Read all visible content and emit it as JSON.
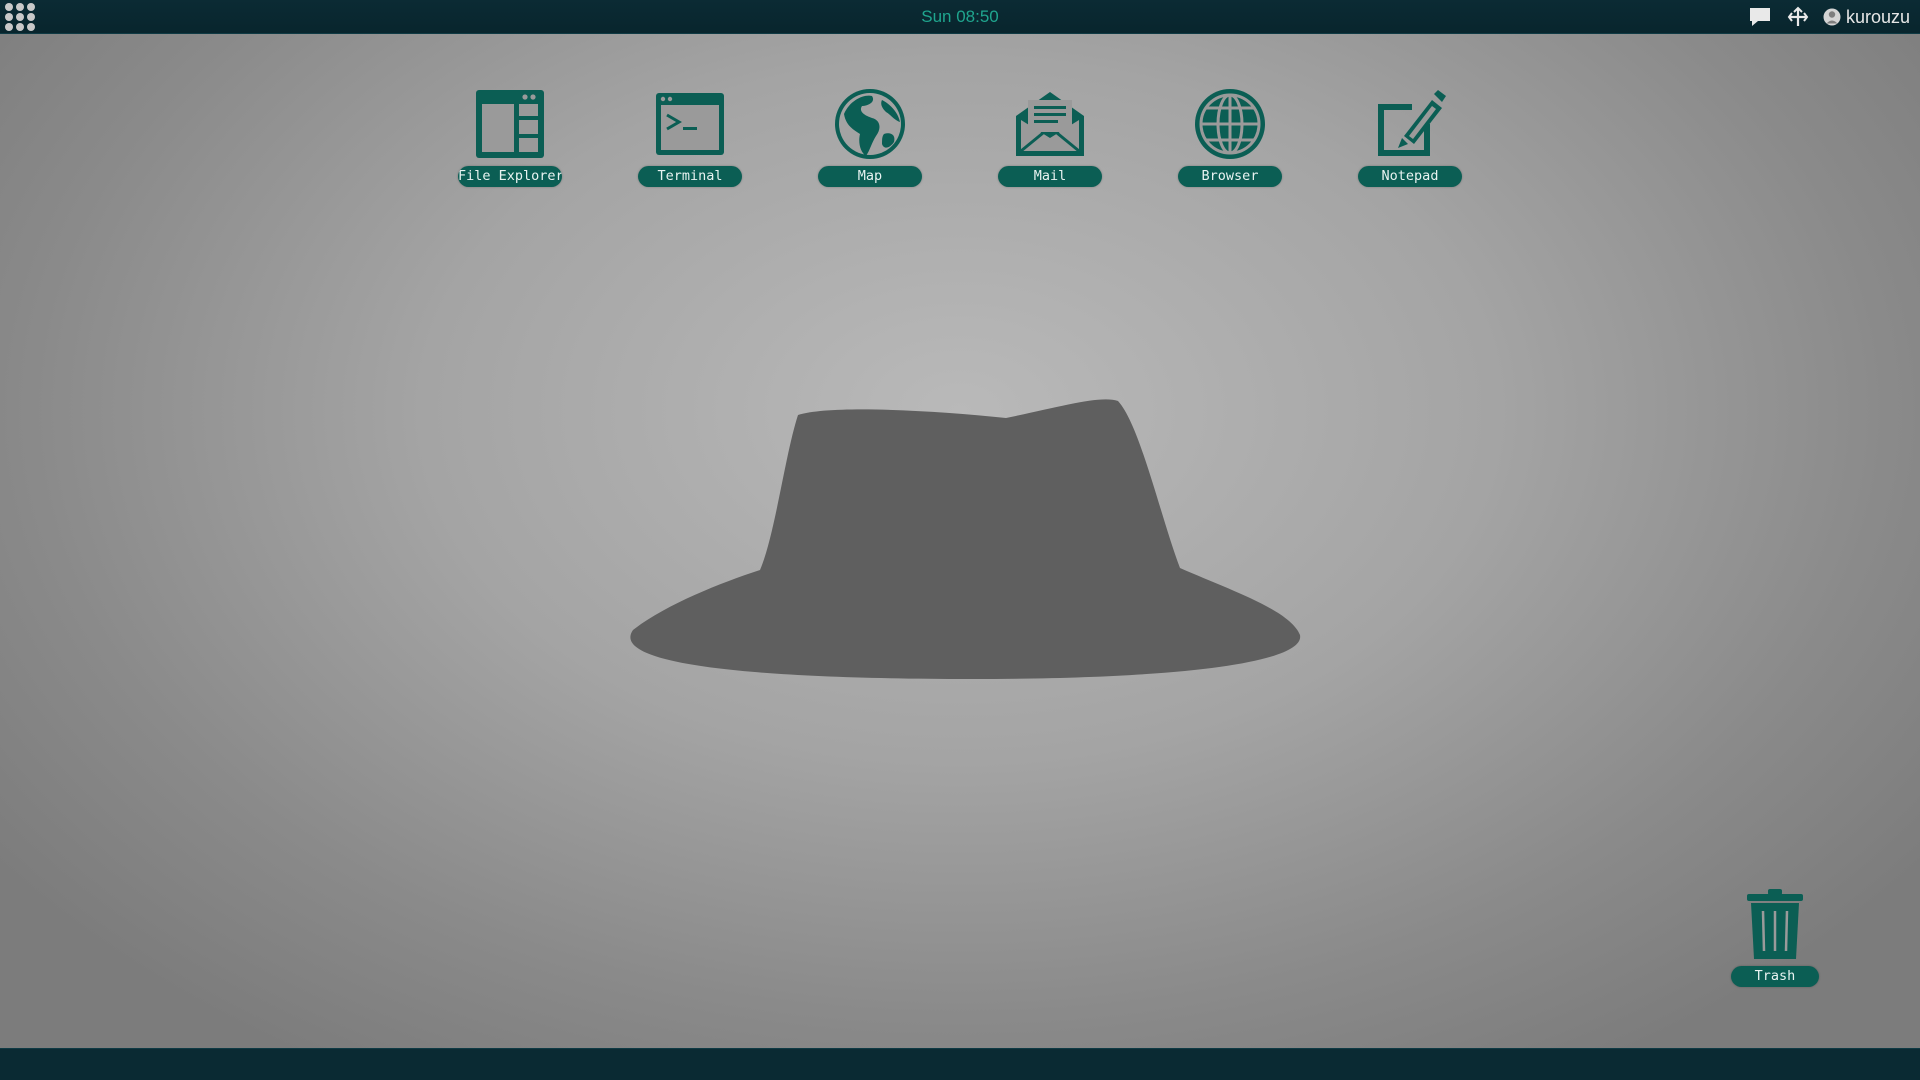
{
  "topbar": {
    "clock": "Sun 08:50",
    "username": "kurouzu",
    "icons": {
      "apps": "app-grid-icon",
      "chat": "chat-bubble-icon",
      "network": "network-icon",
      "user": "user-icon"
    }
  },
  "desktop": {
    "icons": [
      {
        "label": "File Explorer",
        "icon": "file-explorer-icon"
      },
      {
        "label": "Terminal",
        "icon": "terminal-icon"
      },
      {
        "label": "Map",
        "icon": "globe-map-icon"
      },
      {
        "label": "Mail",
        "icon": "mail-icon"
      },
      {
        "label": "Browser",
        "icon": "browser-globe-icon"
      },
      {
        "label": "Notepad",
        "icon": "notepad-icon"
      }
    ],
    "trash": {
      "label": "Trash",
      "icon": "trash-icon"
    },
    "wallpaper": "fedora-hat"
  },
  "colors": {
    "accent": "#0b5e54",
    "icon": "#0b5e54",
    "bar": "#0a2a33",
    "clock": "#1fa58e",
    "hat": "#5f5f5f"
  }
}
